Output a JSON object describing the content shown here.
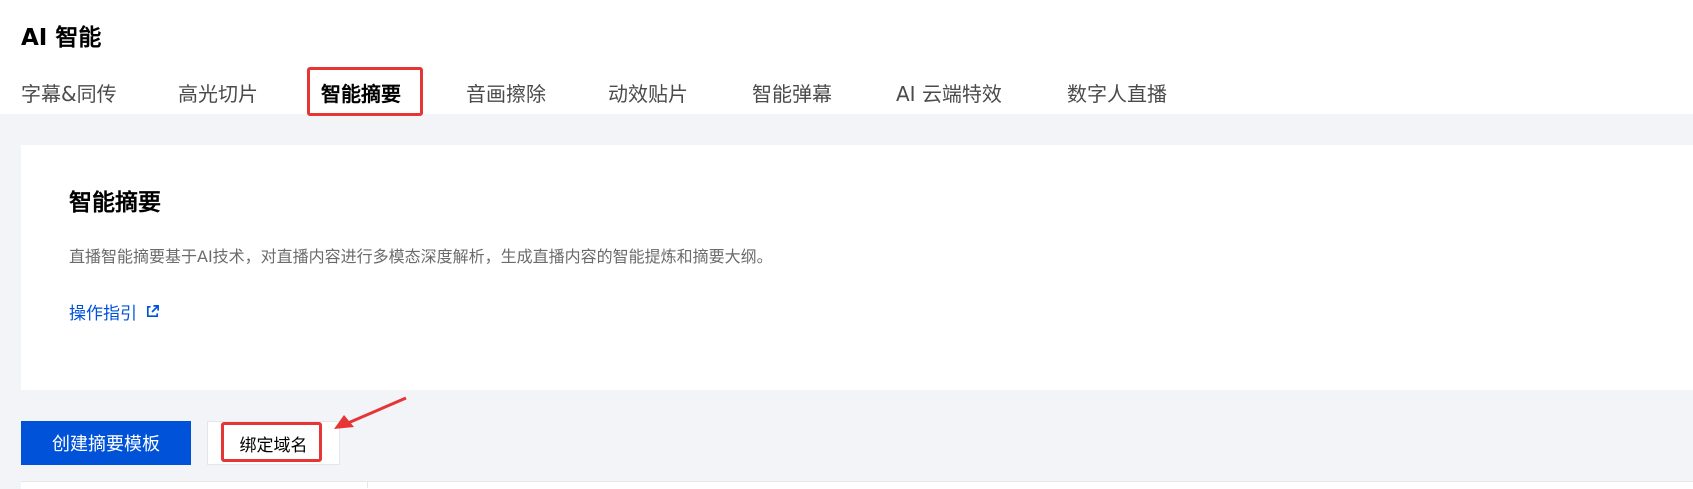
{
  "header": {
    "title": "AI 智能"
  },
  "tabs": [
    {
      "label": "字幕&同传"
    },
    {
      "label": "高光切片"
    },
    {
      "label": "智能摘要",
      "active": true
    },
    {
      "label": "音画擦除"
    },
    {
      "label": "动效贴片"
    },
    {
      "label": "智能弹幕"
    },
    {
      "label": "AI 云端特效"
    },
    {
      "label": "数字人直播"
    }
  ],
  "intro": {
    "title": "智能摘要",
    "description": "直播智能摘要基于AI技术，对直播内容进行多模态深度解析，生成直播内容的智能提炼和摘要大纲。",
    "guide_link": "操作指引"
  },
  "actions": {
    "create_label": "创建摘要模板",
    "bind_label": "绑定域名"
  },
  "colors": {
    "accent": "#0052d9",
    "highlight": "#e53535",
    "background": "#f3f4f7"
  },
  "icons": {
    "guide_link_icon": "external-link-icon",
    "annotation": "red-arrow-icon"
  }
}
